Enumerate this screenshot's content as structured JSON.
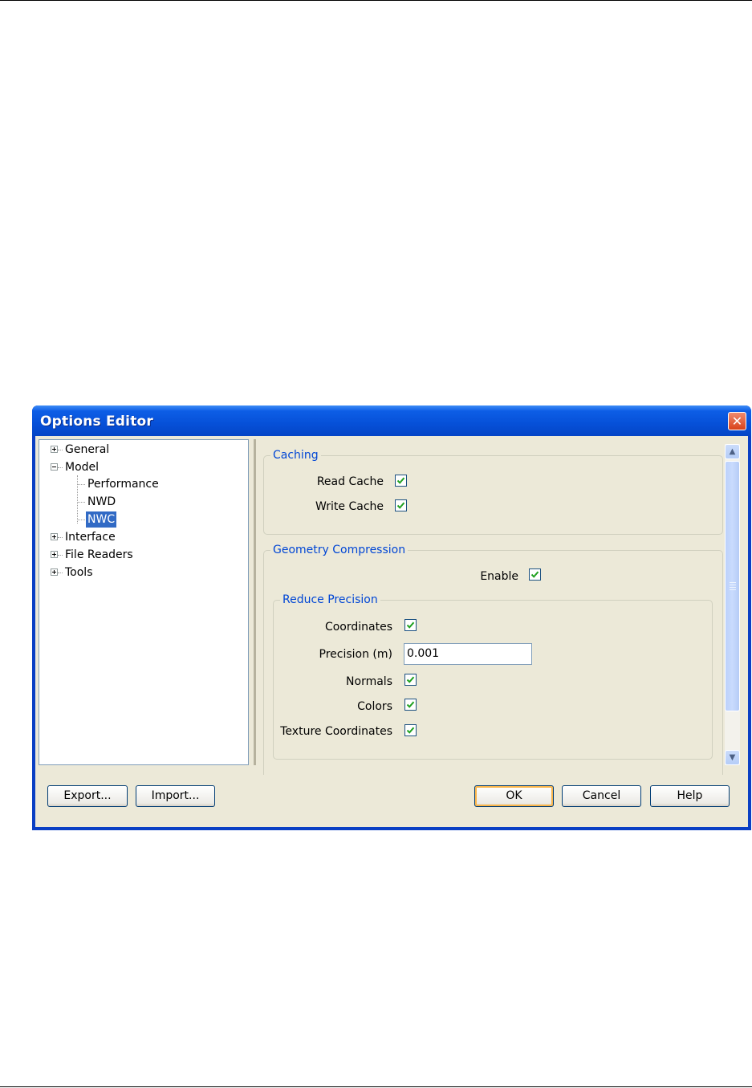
{
  "window": {
    "title": "Options Editor"
  },
  "tree": {
    "items": [
      {
        "label": "General",
        "expander": "plus"
      },
      {
        "label": "Model",
        "expander": "minus"
      },
      {
        "label": "Performance"
      },
      {
        "label": "NWD"
      },
      {
        "label": "NWC",
        "selected": true
      },
      {
        "label": "Interface",
        "expander": "plus"
      },
      {
        "label": "File Readers",
        "expander": "plus"
      },
      {
        "label": "Tools",
        "expander": "plus"
      }
    ]
  },
  "caching": {
    "legend": "Caching",
    "read_cache_label": "Read Cache",
    "read_cache_checked": true,
    "write_cache_label": "Write Cache",
    "write_cache_checked": true
  },
  "geometry": {
    "legend": "Geometry Compression",
    "enable_label": "Enable",
    "enable_checked": true,
    "reduce_precision": {
      "legend": "Reduce Precision",
      "coordinates_label": "Coordinates",
      "coordinates_checked": true,
      "precision_label": "Precision (m)",
      "precision_value": "0.001",
      "normals_label": "Normals",
      "normals_checked": true,
      "colors_label": "Colors",
      "colors_checked": true,
      "texture_label": "Texture Coordinates",
      "texture_checked": true
    }
  },
  "buttons": {
    "export": "Export...",
    "import": "Import...",
    "ok": "OK",
    "cancel": "Cancel",
    "help": "Help"
  },
  "colors": {
    "titlebar": "#0650d8",
    "dialog_face": "#ece9d8",
    "legend_text": "#0046d5",
    "selection": "#316ac5",
    "check": "#21a121"
  }
}
